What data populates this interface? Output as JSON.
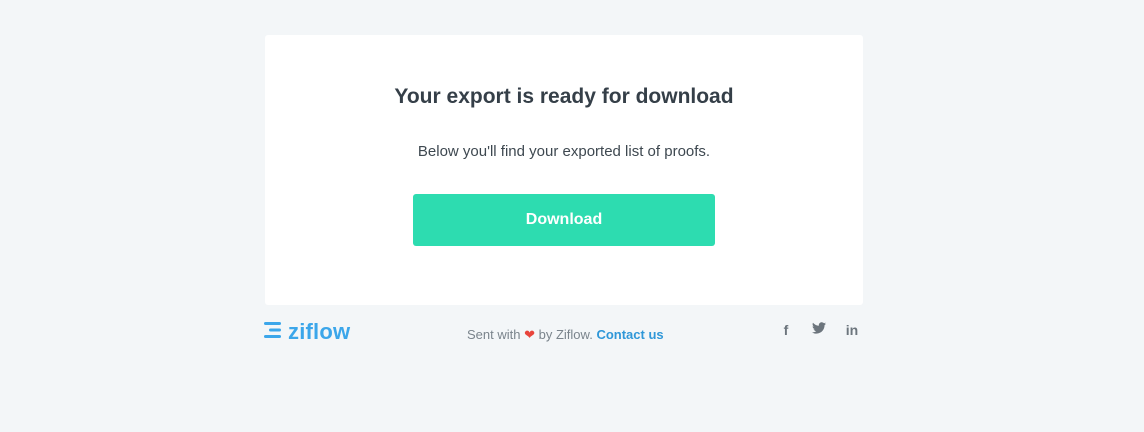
{
  "email": {
    "title": "Your export is ready for download",
    "subtitle": "Below you'll find your exported list of proofs.",
    "download_label": "Download"
  },
  "footer": {
    "brand": "ziflow",
    "sent_prefix": "Sent with",
    "sent_suffix": "by Ziflow.",
    "contact_label": "Contact us",
    "social": {
      "facebook": "f",
      "twitter": "twitter-icon",
      "linkedin": "in"
    }
  },
  "colors": {
    "background": "#f3f6f8",
    "card": "#ffffff",
    "button": "#2ddcb0",
    "brand": "#3ba6ea",
    "link": "#2f97d8",
    "heart": "#e8453c"
  }
}
